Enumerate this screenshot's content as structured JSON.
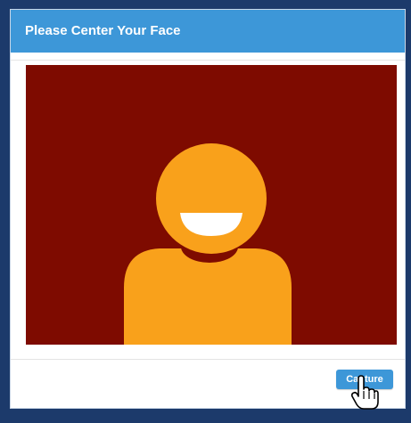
{
  "dialog": {
    "title": "Please Center Your Face",
    "capture_label": "Capture"
  },
  "colors": {
    "background": "#1c3a6b",
    "titlebar": "#3d97d8",
    "preview_bg": "#7e0b00",
    "avatar": "#f9a11b",
    "button": "#3d97d8"
  },
  "icons": {
    "avatar": "person-silhouette-icon",
    "cursor": "hand-pointer-icon"
  }
}
